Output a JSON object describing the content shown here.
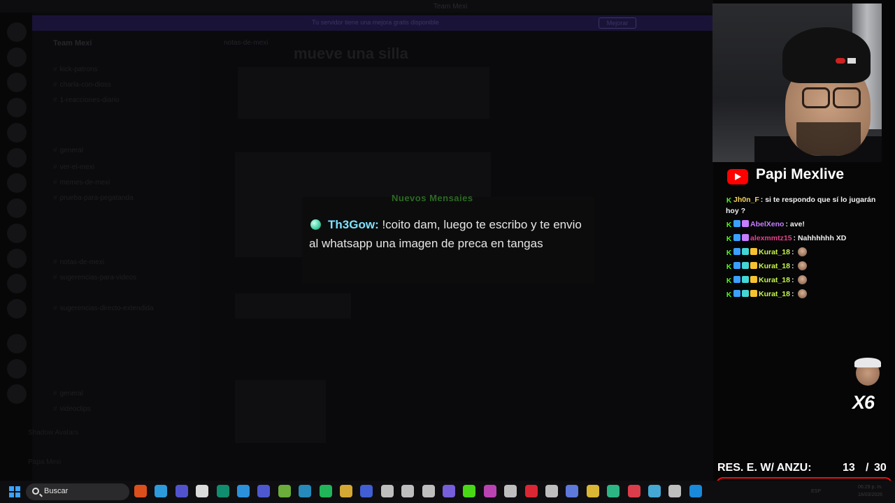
{
  "discord": {
    "window_title": "Team Mexi",
    "banner_text": "Tu servidor tiene una mejora gratis disponible",
    "banner_button": "Mejorar",
    "server_name": "Team Mexi",
    "channels": [
      "kick-patrons",
      "charla-con-dioss",
      "1-reacciones-diario",
      "general",
      "ver-el-mexi",
      "memes-de-mexi",
      "prueba-para-pegatanda",
      "notas-de-mexi",
      "sugerencias-para-videos",
      "sugerencias-directo-extendida",
      "general",
      "videoclips"
    ],
    "active_channel": "notas-de-mexi",
    "heading_ghost": "mueve una silla",
    "user_bottom": "Shadow Avatars",
    "user_bottom2": "Papa Mexi"
  },
  "alert": {
    "header": "Nuevos Mensajes",
    "username": "Th3Gow",
    "message": "!coito dam, luego te escribo y te envio al whatsapp una imagen de preca en tangas"
  },
  "stream": {
    "platform_icon": "youtube-icon",
    "channel_name": "Papi Mexlive"
  },
  "chat": [
    {
      "badges": [
        "k"
      ],
      "user": "Jh0n_F",
      "user_color": "#f5d25b",
      "text": "si te respondo que sí lo jugarán hoy ?",
      "wrap": true
    },
    {
      "badges": [
        "k",
        "b",
        "s"
      ],
      "user": "AbelXeno",
      "user_color": "#c77dff",
      "text": "ave!"
    },
    {
      "badges": [
        "k",
        "b",
        "s"
      ],
      "user": "alexmmtz15",
      "user_color": "#e8408a",
      "text": "Nahhhhhh XD"
    },
    {
      "badges": [
        "k",
        "b",
        "g",
        "y"
      ],
      "user": "Kurat_18",
      "user_color": "#c6f54b",
      "text": "",
      "emote": true
    },
    {
      "badges": [
        "k",
        "b",
        "g",
        "y"
      ],
      "user": "Kurat_18",
      "user_color": "#c6f54b",
      "text": "",
      "emote": true
    },
    {
      "badges": [
        "k",
        "b",
        "g",
        "y"
      ],
      "user": "Kurat_18",
      "user_color": "#c6f54b",
      "text": "",
      "emote": true
    },
    {
      "badges": [
        "k",
        "b",
        "g",
        "y"
      ],
      "user": "Kurat_18",
      "user_color": "#c6f54b",
      "text": "",
      "emote": true
    }
  ],
  "multiplier": "X6",
  "counter": {
    "label": "RES. E. W/ ANZU:",
    "current": "13",
    "separator": "/",
    "total": "30",
    "progress_fraction": 0.43
  },
  "taskbar": {
    "search_placeholder": "Buscar",
    "language": "ESP",
    "time": "06:29 p. m.",
    "date": "16/03/2026",
    "icons": [
      "brave-icon",
      "edge-icon",
      "v-app-icon",
      "capcut-icon",
      "chatgpt-icon",
      "photoshop-icon",
      "discord-icon",
      "xbox-icon",
      "telegram-icon",
      "whatsapp-icon",
      "file-explorer-icon",
      "app-icon",
      "obs-like-icon",
      "media-icon",
      "obs-icon",
      "sound-app-icon",
      "kick-icon",
      "game-icon",
      "screen-app-icon",
      "youtube-icon",
      "mail-icon",
      "game2-icon",
      "sticky-notes-icon",
      "app2-icon",
      "valorant-icon",
      "vpn-icon",
      "g-hub-icon",
      "steam-icon"
    ],
    "icon_colors": [
      "#ff5a1f",
      "#33b3ff",
      "#5d5fef",
      "#ffffff",
      "#10a37f",
      "#31a8ff",
      "#5865f2",
      "#7ac943",
      "#2aa1da",
      "#25d366",
      "#f8c33b",
      "#4a6cf7",
      "#dddddd",
      "#dddddd",
      "#dddddd",
      "#8a6cff",
      "#53fc18",
      "#d84ccf",
      "#dddddd",
      "#ff2b3a",
      "#dddddd",
      "#6a8cff",
      "#ffd43b",
      "#31d49a",
      "#ff4655",
      "#4fc3f7",
      "#dddddd",
      "#1b9fff"
    ]
  }
}
